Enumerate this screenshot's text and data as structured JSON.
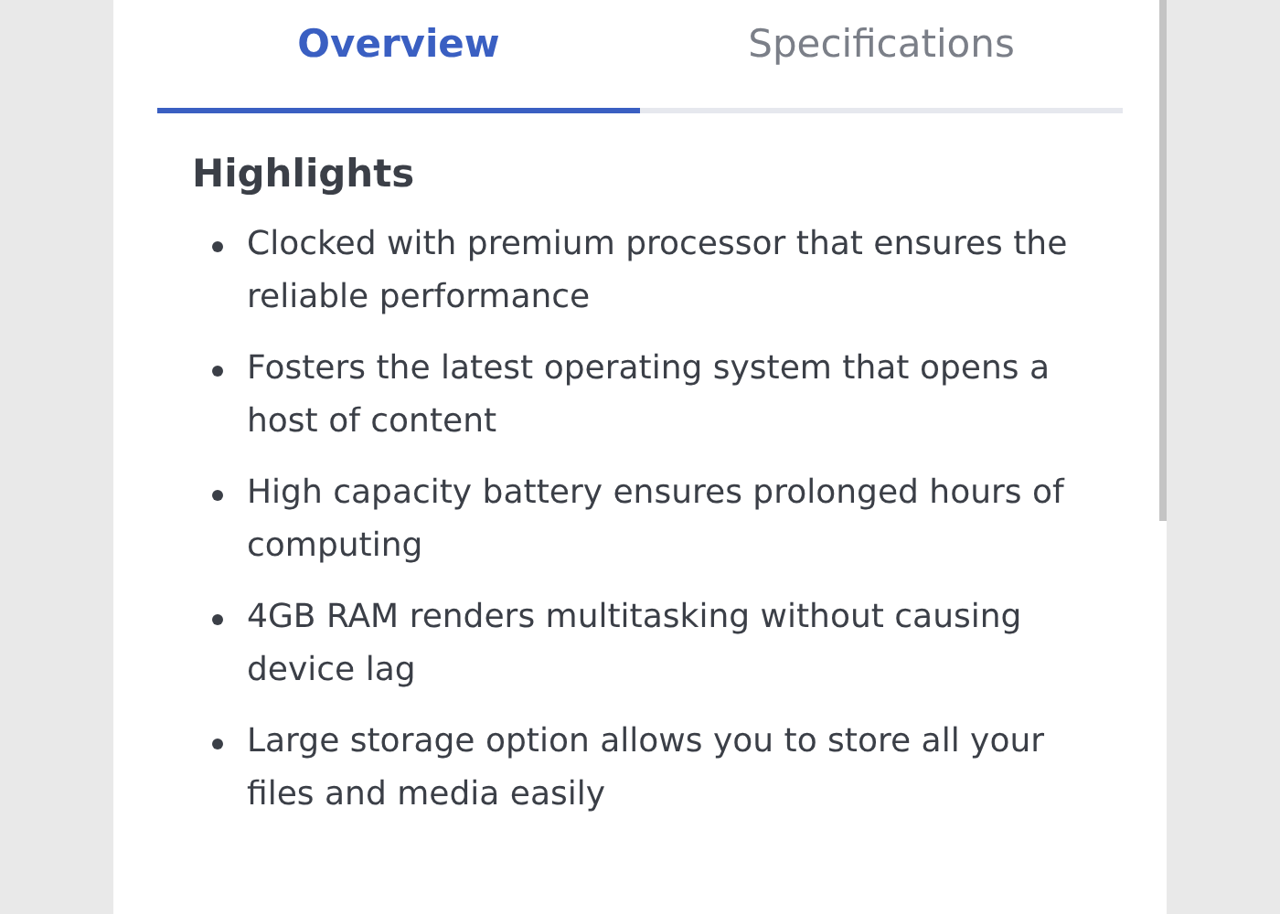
{
  "tabs": [
    {
      "label": "Overview",
      "selected": true
    },
    {
      "label": "Specifications",
      "selected": false
    }
  ],
  "heading": "Highlights",
  "items": [
    "Clocked with premium processor that ensures the reliable performance",
    "Fosters the latest operating system that opens a host of content",
    "High capacity battery ensures prolonged hours of computing",
    "4GB RAM renders multitasking without causing device lag",
    "Large storage option allows you to store all your files and media easily"
  ]
}
